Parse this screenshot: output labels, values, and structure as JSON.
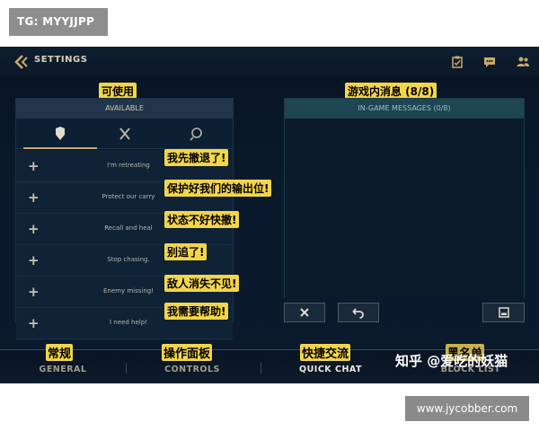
{
  "watermark": {
    "tag": "TG: MYYJJPP",
    "site": "www.jycobber.com",
    "zhihu": "知乎 @爱吃的妖猫"
  },
  "header": {
    "title": "SETTINGS"
  },
  "available": {
    "title": "AVAILABLE",
    "annotation": "可使用",
    "rows": [
      {
        "label": "I'm retreating",
        "annotation": "我先撤退了!"
      },
      {
        "label": "Protect our carry",
        "annotation": "保护好我们的输出位!"
      },
      {
        "label": "Recall and heal",
        "annotation": "状态不好快撤!"
      },
      {
        "label": "Stop chasing.",
        "annotation": "别追了!"
      },
      {
        "label": "Enemy missing!",
        "annotation": "敌人消失不见!"
      },
      {
        "label": "I need help!",
        "annotation": "我需要帮助!"
      }
    ]
  },
  "ingame": {
    "title": "IN-GAME MESSAGES (0/8)",
    "annotation": "游戏内消息 (8/8)"
  },
  "nav": {
    "items": [
      {
        "label": "GENERAL",
        "annotation": "常规"
      },
      {
        "label": "CONTROLS",
        "annotation": "操作面板"
      },
      {
        "label": "QUICK CHAT",
        "annotation": "快捷交流"
      },
      {
        "label": "BLOCK LIST",
        "annotation": "黑名单"
      }
    ]
  },
  "colors": {
    "accent": "#c8aa6e",
    "annotation_bg": "#f3d54a"
  }
}
